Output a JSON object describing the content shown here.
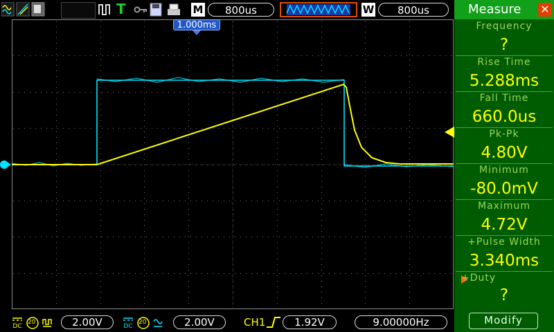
{
  "toolbar": {
    "timebase_mode": "M",
    "timebase_value": "800us",
    "window_mode": "W",
    "window_value": "800us",
    "trigger_label": "T",
    "time_marker": "1.000ms"
  },
  "measure_panel": {
    "title": "Measure",
    "items": [
      {
        "label": "Frequency",
        "value": "?"
      },
      {
        "label": "Rise Time",
        "value": "5.288ms"
      },
      {
        "label": "Fall Time",
        "value": "660.0us"
      },
      {
        "label": "Pk-Pk",
        "value": "4.80V"
      },
      {
        "label": "Minimum",
        "value": "-80.0mV"
      },
      {
        "label": "Maximum",
        "value": "4.72V"
      },
      {
        "label": "+Pulse Width",
        "value": "3.340ms"
      },
      {
        "label": "+Duty",
        "value": "?"
      }
    ],
    "modify_label": "Modify"
  },
  "statusbar": {
    "ch1_scale": "2.00V",
    "ch2_scale": "2.00V",
    "trigger_source": "CH1",
    "trigger_level": "1.92V",
    "frequency": "9.00000Hz",
    "bw_limit_1": "20",
    "bw_limit_2": "20"
  },
  "colors": {
    "ch1": "#ffff00",
    "ch2": "#00e5ff",
    "panel_bg": "#005c00",
    "panel_header": "#12a01a",
    "value_text": "#ffff00"
  }
}
